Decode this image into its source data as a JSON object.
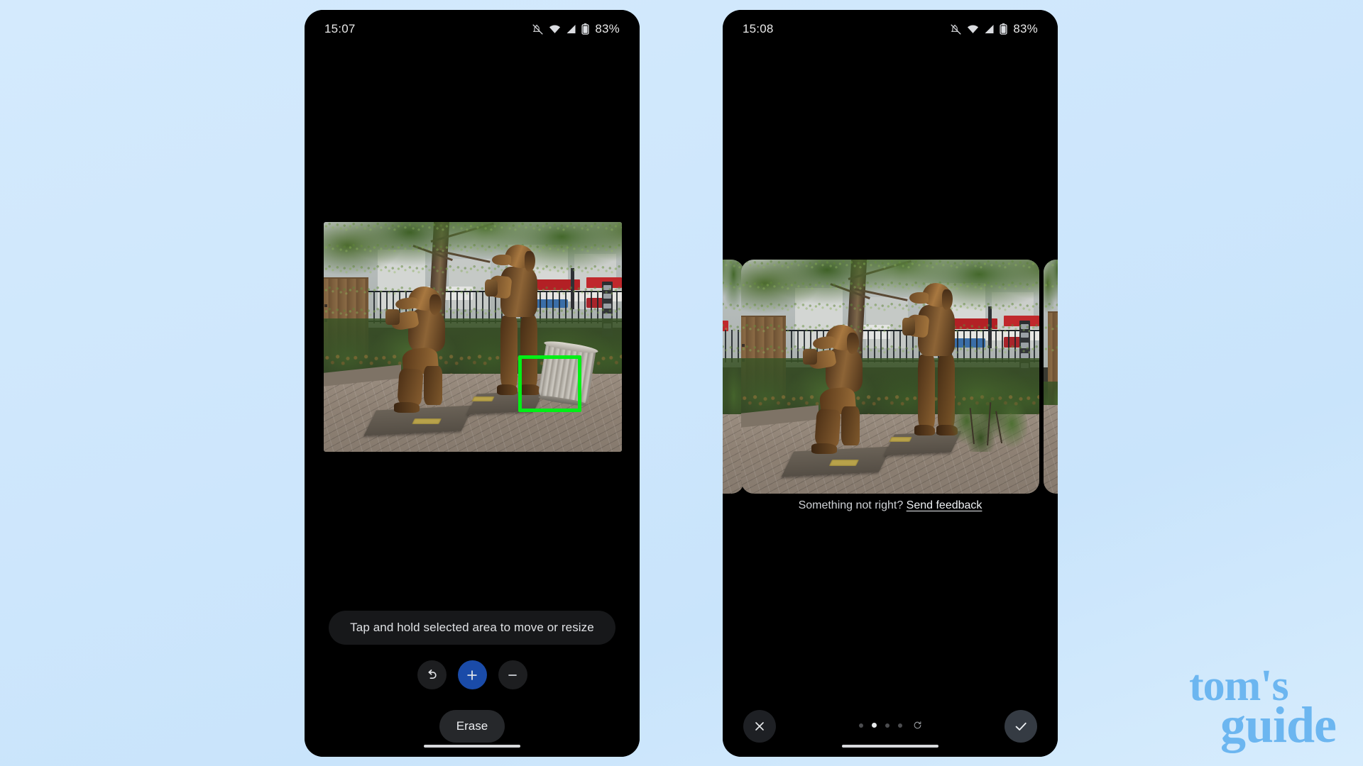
{
  "background": {
    "color_top": "#d4eafd",
    "color_bottom": "#d6ecfd"
  },
  "accent_colors": {
    "highlight_green": "#00ef16",
    "add_button_blue": "#1a4ba8",
    "logo_blue": "#6cb6f0"
  },
  "phones": [
    {
      "id": "left",
      "status_bar": {
        "time": "15:07",
        "icons": [
          "notifications-off-icon",
          "wifi-icon",
          "signal-icon",
          "battery-icon"
        ],
        "battery_percent": "83%"
      },
      "photo": {
        "alt": "Bronze dog photographer statues under a tree on brick pavement",
        "selection_box_label": "selected-area-trash-bin"
      },
      "hint": "Tap and hold selected area to move or resize",
      "tools": [
        {
          "name": "undo-button",
          "icon": "undo-icon",
          "style": "dark"
        },
        {
          "name": "add-brush-button",
          "icon": "plus-icon",
          "style": "accent"
        },
        {
          "name": "subtract-brush-button",
          "icon": "minus-icon",
          "style": "dark"
        }
      ],
      "primary_action": "Erase",
      "annotations": [
        "selection-box-highlight",
        "erase-button-highlight"
      ]
    },
    {
      "id": "right",
      "status_bar": {
        "time": "15:08",
        "icons": [
          "notifications-off-icon",
          "wifi-icon",
          "signal-icon",
          "battery-icon"
        ],
        "battery_percent": "83%"
      },
      "photo": {
        "alt": "Same statue scene with the trash bin erased and replaced by bushes",
        "selection_box_label": "erased-area-result"
      },
      "feedback": {
        "question": "Something not right?",
        "link": "Send feedback"
      },
      "bottom_controls": {
        "cancel": {
          "name": "cancel-button",
          "icon": "close-icon"
        },
        "confirm": {
          "name": "confirm-button",
          "icon": "check-icon"
        },
        "pager": {
          "total_dots": 4,
          "active_index": 1,
          "extra_icon": "refresh-icon"
        }
      },
      "annotations": [
        "result-area-highlight"
      ]
    }
  ],
  "watermark": {
    "line1": "tom's",
    "line2": "guide"
  }
}
